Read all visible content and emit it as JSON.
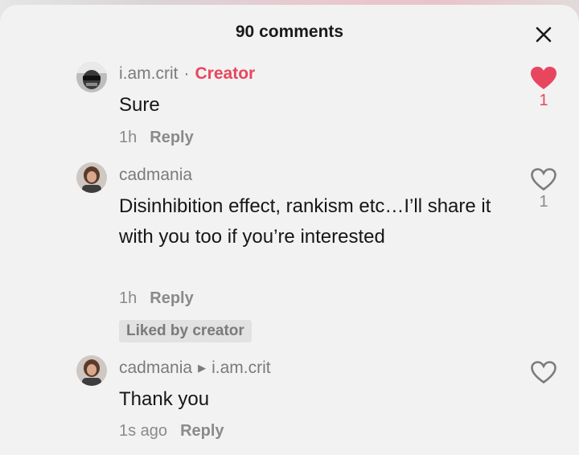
{
  "header": {
    "title": "90 comments"
  },
  "comments": [
    {
      "username": "i.am.crit",
      "separator": "·",
      "badge": "Creator",
      "text": "Sure",
      "time": "1h",
      "reply_label": "Reply",
      "liked": true,
      "like_count": "1"
    },
    {
      "username": "cadmania",
      "text": "Disinhibition effect, rankism etc…I’ll share it with you too if you’re interested",
      "time": "1h",
      "reply_label": "Reply",
      "liked_by_creator": "Liked by creator",
      "liked": false,
      "like_count": "1"
    },
    {
      "username": "cadmania",
      "reply_to": "i.am.crit",
      "text": "Thank you",
      "time": "1s ago",
      "reply_label": "Reply",
      "liked": false
    }
  ],
  "colors": {
    "accent": "#e8465f",
    "text": "#161616",
    "muted": "#8a8a8a",
    "sheet": "#f2f2f2"
  },
  "icons": {
    "close": "close-icon",
    "like": "heart-icon"
  }
}
